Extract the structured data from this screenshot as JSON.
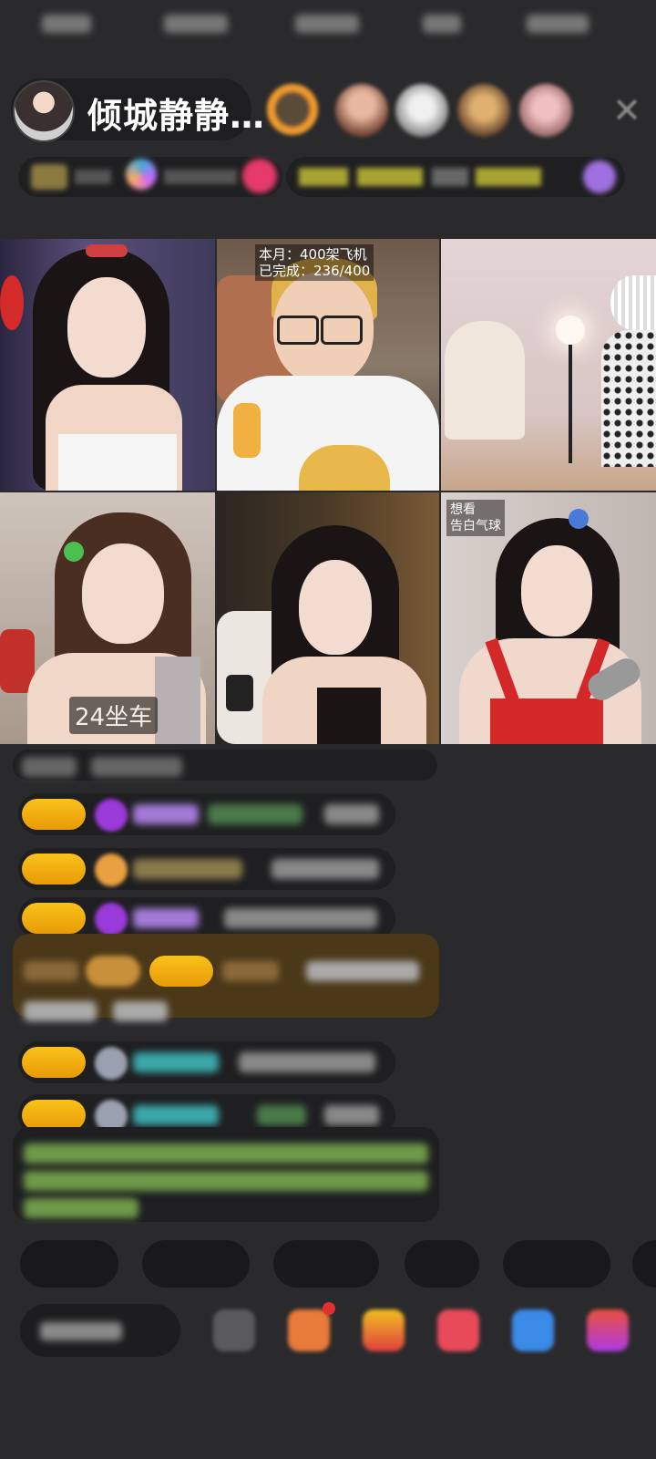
{
  "header": {
    "host_name": "倾城静静…",
    "close_icon": "close-icon"
  },
  "tiles": [
    {
      "id": "tile-1"
    },
    {
      "id": "tile-2",
      "overlay_text": "本月：400架飞机\n已完成：236/400"
    },
    {
      "id": "tile-3"
    },
    {
      "id": "tile-4",
      "seat_label": "24坐车"
    },
    {
      "id": "tile-5"
    },
    {
      "id": "tile-6",
      "overlay_text": "想看\n告白气球"
    }
  ],
  "colors": {
    "background": "#2a2a2c",
    "badge": "#f9c21a",
    "system_message": "#4a3818",
    "notice_text": "#8fd14f",
    "name_purple": "#a27ad6",
    "name_teal": "#3aa6a8"
  }
}
